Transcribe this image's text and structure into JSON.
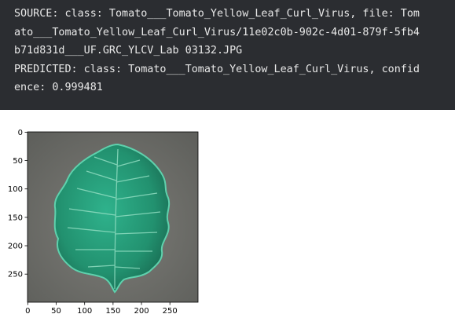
{
  "output": {
    "lines": [
      "SOURCE: class: Tomato___Tomato_Yellow_Leaf_Curl_Virus, file: Tom",
      "ato___Tomato_Yellow_Leaf_Curl_Virus/11e02c0b-902c-4d01-879f-5fb4",
      "b71d831d___UF.GRC_YLCV_Lab 03132.JPG",
      "PREDICTED: class: Tomato___Tomato_Yellow_Leaf_Curl_Virus, confid",
      "ence: 0.999481"
    ]
  },
  "plot": {
    "x_ticks": [
      "0",
      "50",
      "100",
      "150",
      "200",
      "250"
    ],
    "y_ticks": [
      "0",
      "50",
      "100",
      "150",
      "200",
      "250"
    ],
    "x_range": [
      0,
      299
    ],
    "y_range": [
      0,
      299
    ],
    "colors": {
      "background": "#6e6e6a",
      "leaf": "#2aa783",
      "leaf_dark": "#1d7a5e",
      "vein": "#9be0c6"
    }
  }
}
